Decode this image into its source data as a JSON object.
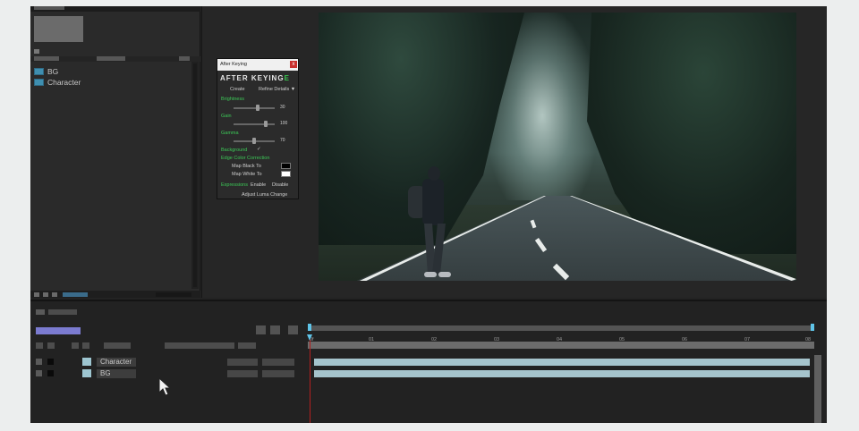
{
  "project": {
    "items": [
      {
        "label": "BG"
      },
      {
        "label": "Character"
      }
    ]
  },
  "after_keying": {
    "title": "After Keying",
    "close": "x",
    "logo_main": "AFTER KEYING",
    "logo_accent": "E",
    "create_label": "Create",
    "refine_label": "Refine Details",
    "brightness_label": "Brightness",
    "brightness_value": "30",
    "brightness_level": 0.6,
    "gain_label": "Gain",
    "gain_value": "100",
    "gain_level": 0.8,
    "gamma_label": "Gamma",
    "gamma_value": "70",
    "gamma_level": 0.5,
    "background_label": "Background",
    "background_checked": "✓",
    "edge_label": "Edge Color Correction",
    "map_black_label": "Map Black To",
    "map_white_label": "Map White To",
    "map_black_color": "#000000",
    "map_white_color": "#ffffff",
    "expressions_label": "Expressions",
    "enable_label": "Enable",
    "disable_label": "Disable",
    "luma_label": "Adjust Luma Change",
    "accent_color": "#3cc957"
  },
  "timeline": {
    "ticks": [
      "0f",
      "01",
      "02",
      "03",
      "04",
      "05",
      "06",
      "07",
      "08"
    ],
    "layers": [
      {
        "name": "Character"
      },
      {
        "name": "BG"
      }
    ]
  }
}
